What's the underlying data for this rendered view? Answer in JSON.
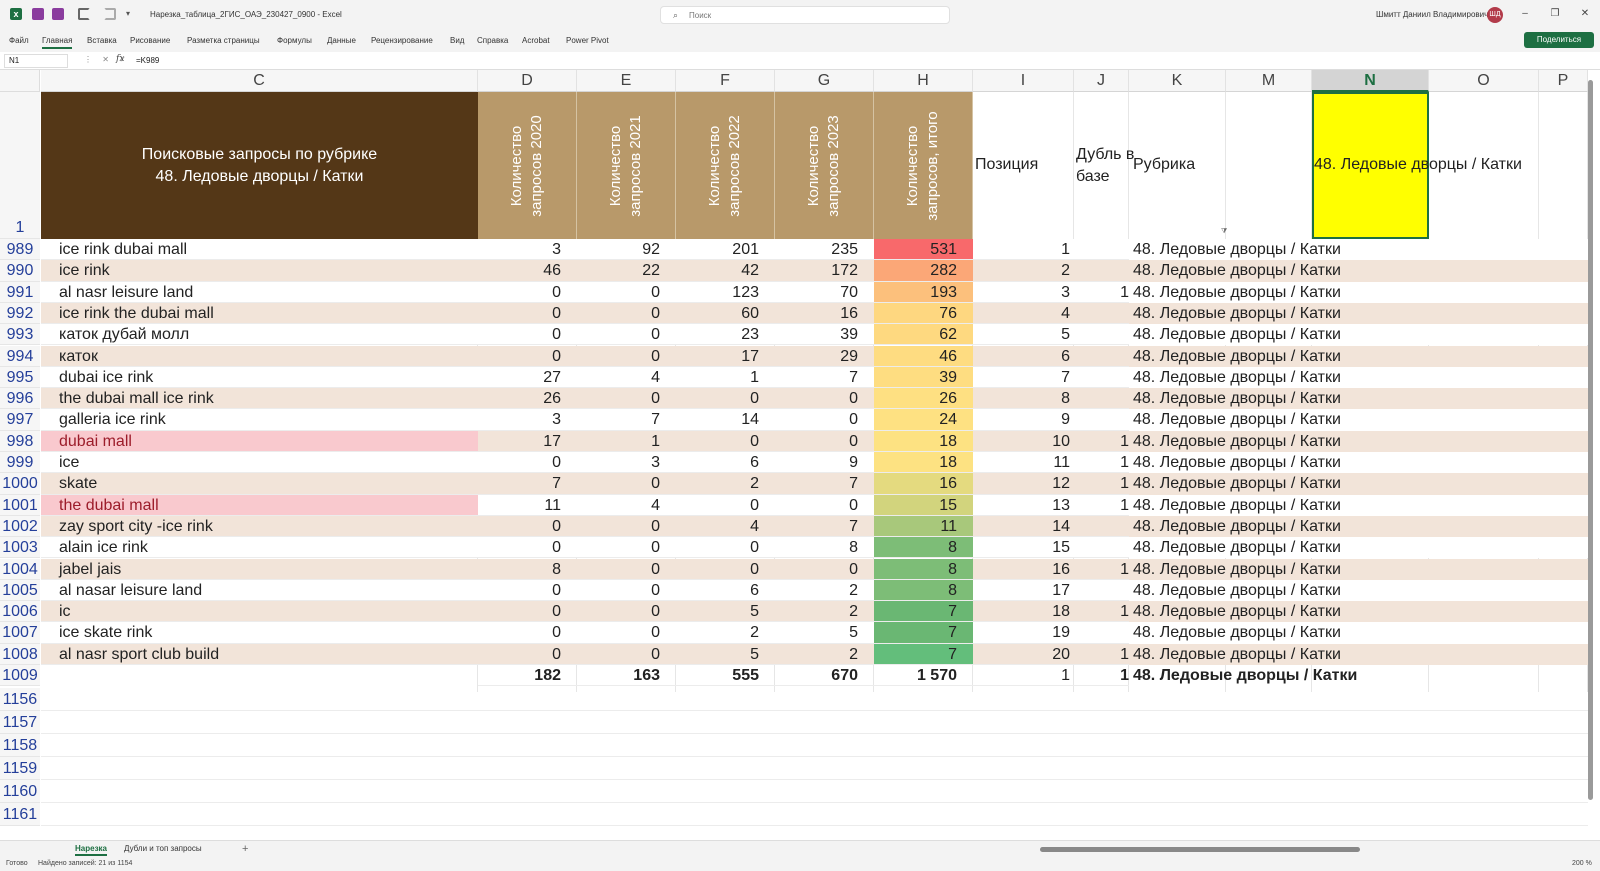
{
  "titlebar": {
    "title": "Нарезка_таблица_2ГИС_ОАЭ_230427_0900  -  Excel",
    "search_placeholder": "Поиск",
    "user_name": "Шмитт Даниил Владимирович",
    "user_initials": "ШД",
    "quick_access_more": "▾",
    "minimize": "–",
    "restore": "❐",
    "close": "✕"
  },
  "ribbon": {
    "tabs": [
      "Файл",
      "Главная",
      "Вставка",
      "Рисование",
      "Разметка страницы",
      "Формулы",
      "Данные",
      "Рецензирование",
      "Вид",
      "Справка",
      "Acrobat",
      "Power Pivot"
    ],
    "active_tab": "Главная",
    "share_label": "Поделиться"
  },
  "formula_bar": {
    "name_box": "N1",
    "fx": "fx",
    "formula": "=K989",
    "icons": "⋮ ✕ ✓"
  },
  "columns": [
    "C",
    "D",
    "E",
    "F",
    "G",
    "H",
    "I",
    "J",
    "K",
    "M",
    "N",
    "O",
    "P"
  ],
  "selected_column": "N",
  "header_row": {
    "row_number": "1",
    "c_title": "Поисковые запросы по рубрике",
    "c_subtitle": "48. Ледовые дворцы / Катки",
    "d": "Количество запросов 2020",
    "e": "Количество запросов 2021",
    "f": "Количество запросов 2022",
    "g": "Количество запросов 2023",
    "h": "Количество запросов, итого",
    "i": "Позиция",
    "j": "Дубль в базе",
    "k": "Рубрика",
    "n": "48. Ледовые дворцы / Катки"
  },
  "rows": [
    {
      "n": "989",
      "q": "ice rink dubai mall",
      "d": "3",
      "e": "92",
      "f": "201",
      "g": "235",
      "h": "531",
      "pos": "1",
      "dup": "",
      "rub": "48. Ледовые дворцы / Катки",
      "hc": "#f8696b",
      "pink": false
    },
    {
      "n": "990",
      "q": "ice rink",
      "d": "46",
      "e": "22",
      "f": "42",
      "g": "172",
      "h": "282",
      "pos": "2",
      "dup": "",
      "rub": "48. Ледовые дворцы / Катки",
      "hc": "#fba777",
      "pink": false
    },
    {
      "n": "991",
      "q": "al nasr leisure land",
      "d": "0",
      "e": "0",
      "f": "123",
      "g": "70",
      "h": "193",
      "pos": "3",
      "dup": "1",
      "rub": "48. Ледовые дворцы / Катки",
      "hc": "#fcc07c",
      "pink": false
    },
    {
      "n": "992",
      "q": "ice rink the dubai mall",
      "d": "0",
      "e": "0",
      "f": "60",
      "g": "16",
      "h": "76",
      "pos": "4",
      "dup": "",
      "rub": "48. Ледовые дворцы / Катки",
      "hc": "#fed780",
      "pink": false
    },
    {
      "n": "993",
      "q": "каток дубай молл",
      "d": "0",
      "e": "0",
      "f": "23",
      "g": "39",
      "h": "62",
      "pos": "5",
      "dup": "",
      "rub": "48. Ледовые дворцы / Катки",
      "hc": "#fed980",
      "pink": false
    },
    {
      "n": "994",
      "q": "каток",
      "d": "0",
      "e": "0",
      "f": "17",
      "g": "29",
      "h": "46",
      "pos": "6",
      "dup": "",
      "rub": "48. Ледовые дворцы / Катки",
      "hc": "#fedc81",
      "pink": false
    },
    {
      "n": "995",
      "q": "dubai ice rink",
      "d": "27",
      "e": "4",
      "f": "1",
      "g": "7",
      "h": "39",
      "pos": "7",
      "dup": "",
      "rub": "48. Ледовые дворцы / Катки",
      "hc": "#fedd81",
      "pink": false
    },
    {
      "n": "996",
      "q": "the dubai mall ice rink",
      "d": "26",
      "e": "0",
      "f": "0",
      "g": "0",
      "h": "26",
      "pos": "8",
      "dup": "",
      "rub": "48. Ледовые дворцы / Катки",
      "hc": "#fee082",
      "pink": false
    },
    {
      "n": "997",
      "q": "galleria ice rink",
      "d": "3",
      "e": "7",
      "f": "14",
      "g": "0",
      "h": "24",
      "pos": "9",
      "dup": "",
      "rub": "48. Ледовые дворцы / Катки",
      "hc": "#fee182",
      "pink": false
    },
    {
      "n": "998",
      "q": "dubai mall",
      "d": "17",
      "e": "1",
      "f": "0",
      "g": "0",
      "h": "18",
      "pos": "10",
      "dup": "1",
      "rub": "48. Ледовые дворцы / Катки",
      "hc": "#fde282",
      "pink": true
    },
    {
      "n": "999",
      "q": "ice",
      "d": "0",
      "e": "3",
      "f": "6",
      "g": "9",
      "h": "18",
      "pos": "11",
      "dup": "1",
      "rub": "48. Ледовые дворцы / Катки",
      "hc": "#fde282",
      "pink": false
    },
    {
      "n": "1000",
      "q": "skate",
      "d": "7",
      "e": "0",
      "f": "2",
      "g": "7",
      "h": "16",
      "pos": "12",
      "dup": "1",
      "rub": "48. Ледовые дворцы / Катки",
      "hc": "#e4da7f",
      "pink": false
    },
    {
      "n": "1001",
      "q": "the dubai mall",
      "d": "11",
      "e": "4",
      "f": "0",
      "g": "0",
      "h": "15",
      "pos": "13",
      "dup": "1",
      "rub": "48. Ледовые дворцы / Катки",
      "hc": "#d2d47d",
      "pink": true
    },
    {
      "n": "1002",
      "q": "zay sport city -ice rink",
      "d": "0",
      "e": "0",
      "f": "4",
      "g": "7",
      "h": "11",
      "pos": "14",
      "dup": "",
      "rub": "48. Ледовые дворцы / Катки",
      "hc": "#a8c87b",
      "pink": false
    },
    {
      "n": "1003",
      "q": "alain ice rink",
      "d": "0",
      "e": "0",
      "f": "0",
      "g": "8",
      "h": "8",
      "pos": "15",
      "dup": "",
      "rub": "48. Ледовые дворцы / Катки",
      "hc": "#7dbd77",
      "pink": false
    },
    {
      "n": "1004",
      "q": "jabel jais",
      "d": "8",
      "e": "0",
      "f": "0",
      "g": "0",
      "h": "8",
      "pos": "16",
      "dup": "1",
      "rub": "48. Ледовые дворцы / Катки",
      "hc": "#7dbd77",
      "pink": false
    },
    {
      "n": "1005",
      "q": "al nasar leisure land",
      "d": "0",
      "e": "0",
      "f": "6",
      "g": "2",
      "h": "8",
      "pos": "17",
      "dup": "",
      "rub": "48. Ледовые дворцы / Катки",
      "hc": "#7dbd77",
      "pink": false
    },
    {
      "n": "1006",
      "q": "ic",
      "d": "0",
      "e": "0",
      "f": "5",
      "g": "2",
      "h": "7",
      "pos": "18",
      "dup": "1",
      "rub": "48. Ледовые дворцы / Катки",
      "hc": "#6ab773",
      "pink": false
    },
    {
      "n": "1007",
      "q": "ice skate rink",
      "d": "0",
      "e": "0",
      "f": "2",
      "g": "5",
      "h": "7",
      "pos": "19",
      "dup": "",
      "rub": "48. Ледовые дворцы / Катки",
      "hc": "#6ab773",
      "pink": false
    },
    {
      "n": "1008",
      "q": "al nasr sport club build",
      "d": "0",
      "e": "0",
      "f": "5",
      "g": "2",
      "h": "7",
      "pos": "20",
      "dup": "1",
      "rub": "48. Ледовые дворцы / Катки",
      "hc": "#63be7b",
      "pink": false
    }
  ],
  "total_row": {
    "n": "1009",
    "d": "182",
    "e": "163",
    "f": "555",
    "g": "670",
    "h": "1 570",
    "pos": "1",
    "dup": "1",
    "rub": "48. Ледовые дворцы / Катки"
  },
  "empty_rows": [
    "1156",
    "1157",
    "1158",
    "1159",
    "1160",
    "1161"
  ],
  "sheet_tabs": [
    "Нарезка",
    "Дубли и топ запросы"
  ],
  "active_sheet": "Нарезка",
  "status": {
    "ready": "Готово",
    "found": "Найдено записей: 21 из 1154",
    "zoom": "200 %"
  },
  "colors": {
    "header_dark": "#543717",
    "header_tan": "#b8996a",
    "band_row": "#f2e4d9",
    "pink_row": "#f9c9ce",
    "excel_green": "#1d6f42",
    "selected_cell": "#ffff00"
  }
}
